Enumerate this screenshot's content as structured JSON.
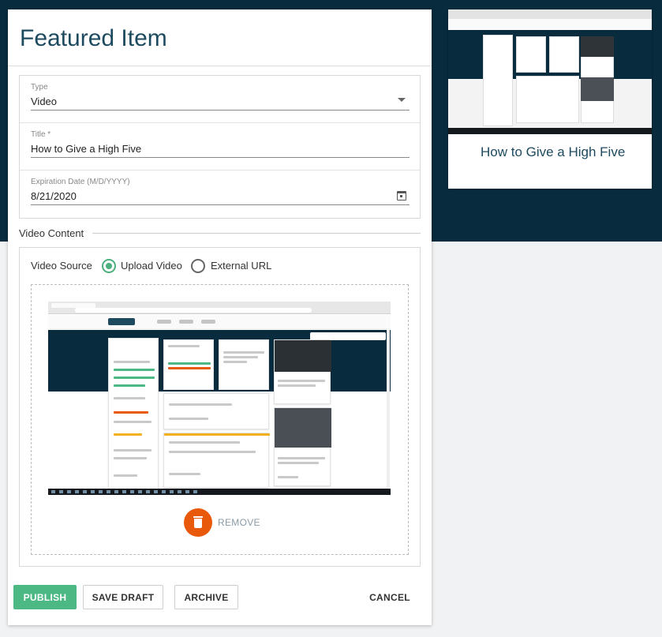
{
  "dialog": {
    "title": "Featured Item",
    "type_field": {
      "label": "Type",
      "value": "Video"
    },
    "title_field": {
      "label": "Title *",
      "value": "How to Give a High Five"
    },
    "expiration_field": {
      "label": "Expiration Date (M/D/YYYY)",
      "value": "8/21/2020"
    },
    "video_content_label": "Video Content",
    "video_source": {
      "label": "Video Source",
      "options": [
        {
          "label": "Upload Video",
          "selected": true
        },
        {
          "label": "External URL",
          "selected": false
        }
      ]
    },
    "remove_label": "REMOVE",
    "buttons": {
      "publish": "PUBLISH",
      "save_draft": "SAVE DRAFT",
      "archive": "ARCHIVE",
      "cancel": "CANCEL"
    }
  },
  "side_card": {
    "title": "How to Give a High Five"
  },
  "colors": {
    "dark_header": "#082c3d",
    "accent_green": "#4cb883",
    "remove_orange": "#e8590c",
    "title_blue": "#1e4a5f"
  },
  "icons": [
    "chevron-down-icon",
    "calendar-icon",
    "trash-icon"
  ]
}
